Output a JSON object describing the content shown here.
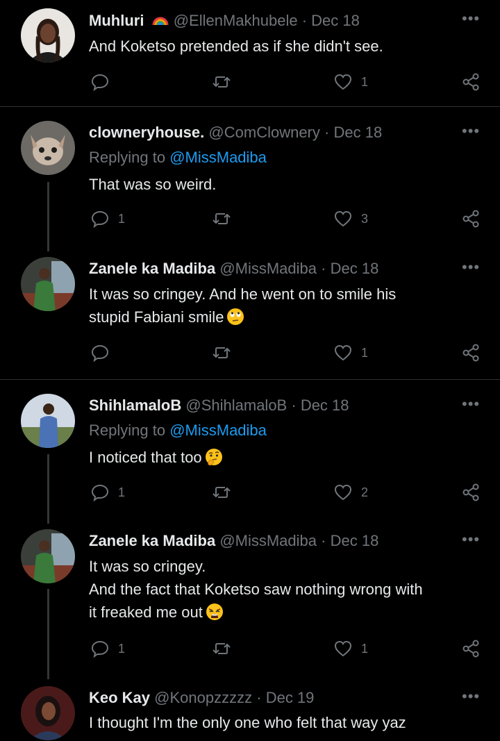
{
  "tweets": [
    {
      "name": "Muhluri",
      "emoji_after_name": "rainbow",
      "handle": "@EllenMakhubele",
      "sep": "·",
      "date": "Dec 18",
      "replying_label": "",
      "replying_to": "",
      "lines": [
        "And Koketso pretended as if she didn't see."
      ],
      "text_emoji": "",
      "replies": "",
      "retweets": "",
      "likes": "1"
    },
    {
      "name": "clowneryhouse.",
      "handle": "@ComClownery",
      "sep": "·",
      "date": "Dec 18",
      "replying_label": "Replying to",
      "replying_to": "@MissMadiba",
      "lines": [
        "That was so weird."
      ],
      "text_emoji": "",
      "replies": "1",
      "retweets": "",
      "likes": "3"
    },
    {
      "name": "Zanele ka Madiba",
      "handle": "@MissMadiba",
      "sep": "·",
      "date": "Dec 18",
      "replying_label": "",
      "replying_to": "",
      "lines": [
        "It was so cringey. And he went on to smile his",
        "stupid Fabiani smile"
      ],
      "text_emoji": "face-with-rolling-eyes",
      "replies": "",
      "retweets": "",
      "likes": "1"
    },
    {
      "name": "ShihlamaloB",
      "handle": "@ShihlamaloB",
      "sep": "·",
      "date": "Dec 18",
      "replying_label": "Replying to",
      "replying_to": "@MissMadiba",
      "lines": [
        "I noticed that too"
      ],
      "text_emoji": "thinking-face",
      "replies": "1",
      "retweets": "",
      "likes": "2"
    },
    {
      "name": "Zanele ka Madiba",
      "handle": "@MissMadiba",
      "sep": "·",
      "date": "Dec 18",
      "replying_label": "",
      "replying_to": "",
      "lines": [
        "It was so cringey.",
        "And the fact that Koketso saw nothing wrong with",
        "it freaked me out"
      ],
      "text_emoji": "weary-face",
      "replies": "1",
      "retweets": "",
      "likes": "1"
    },
    {
      "name": "Keo Kay",
      "handle": "@Konopzzzzz",
      "sep": "·",
      "date": "Dec 19",
      "replying_label": "",
      "replying_to": "",
      "lines": [
        "I thought I'm the only one who felt that way yaz"
      ],
      "text_emoji": "",
      "replies": "",
      "retweets": "",
      "likes": ""
    }
  ],
  "more_label": "•••",
  "colors": {
    "background": "#000000",
    "primary_text": "#e7e9ea",
    "secondary_text": "#71767b",
    "mention": "#1d9bf0",
    "thread_line": "#333639",
    "divider": "#2f3336"
  },
  "icons": {
    "reply": "reply-icon",
    "retweet": "retweet-icon",
    "like": "heart-icon",
    "share": "share-icon",
    "more": "more-options-icon"
  }
}
